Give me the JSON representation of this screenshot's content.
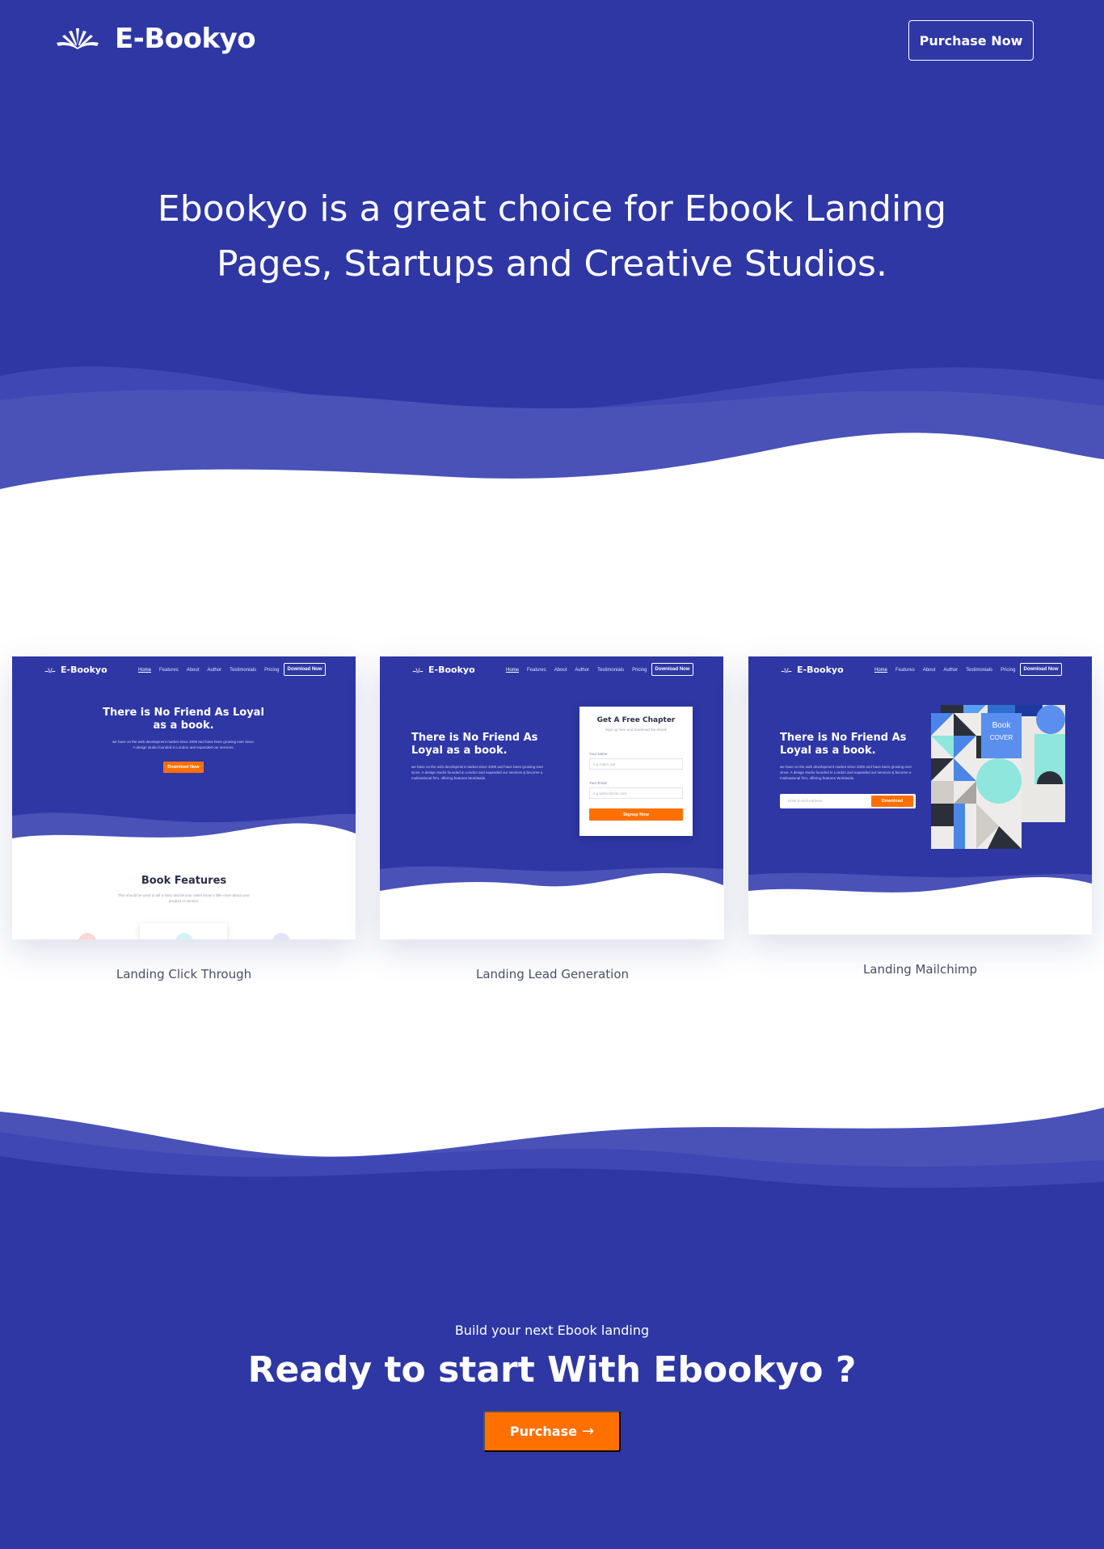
{
  "colors": {
    "brand_blue": "#2e37a4",
    "brand_blue_light": "#4a52b8",
    "accent_orange": "#ff7000",
    "white": "#ffffff"
  },
  "header": {
    "logo_icon": "open-book-icon",
    "logo_text": "E-Bookyo",
    "purchase_button": "Purchase Now"
  },
  "hero": {
    "title": "Ebookyo is a great choice for Ebook Landing Pages, Startups and Creative Studios."
  },
  "demos": [
    {
      "caption": "Landing Click Through",
      "preview": {
        "logo": "E-Bookyo",
        "menu": [
          "Home",
          "Features",
          "About",
          "Author",
          "Testimonials",
          "Pricing"
        ],
        "nav_button": "Download Now",
        "headline": "There is No Friend As Loyal as a book.",
        "text": "we have on the web development market since 2008 and have been growing ever since. A design studio founded in London and expanded our services.",
        "cta": "Download Now",
        "section_title": "Book Features",
        "section_text": "This should be used to tell a story and let your users know a little more about your product or service."
      }
    },
    {
      "caption": "Landing Lead Generation",
      "preview": {
        "logo": "E-Bookyo",
        "menu": [
          "Home",
          "Features",
          "About",
          "Author",
          "Testimonials",
          "Pricing"
        ],
        "nav_button": "Download Now",
        "headline": "There is No Friend As Loyal as a book.",
        "text": "we have on the web development market since 2008 and have been growing ever since. A design studio founded in London and expanded our services & become a multinational firm, offering features Worldwide.",
        "form_title": "Get A Free Chapter",
        "form_subtitle": "Sign up here and download the ebook",
        "name_label": "Your Name",
        "name_placeholder": "e.g Adam Joe",
        "email_label": "Your Email",
        "email_placeholder": "e.g.admin@site.com",
        "submit": "Signup Now"
      }
    },
    {
      "caption": "Landing Mailchimp",
      "preview": {
        "logo": "E-Bookyo",
        "menu": [
          "Home",
          "Features",
          "About",
          "Author",
          "Testimonials",
          "Pricing"
        ],
        "nav_button": "Download Now",
        "headline": "There is No Friend As Loyal as a book.",
        "text": "we have on the web development market since 2008 and have been growing ever since. A design studio founded in London and expanded our services & become a multinational firm, offering features Worldwide.",
        "email_placeholder": "Enter E-mail Address",
        "submit": "Download",
        "book_title": "Book",
        "book_subtitle": "COVER"
      }
    }
  ],
  "cta": {
    "subtitle": "Build your next Ebook landing",
    "title": "Ready to start With Ebookyo ?",
    "button": "Purchase",
    "button_icon": "arrow-right-icon"
  }
}
